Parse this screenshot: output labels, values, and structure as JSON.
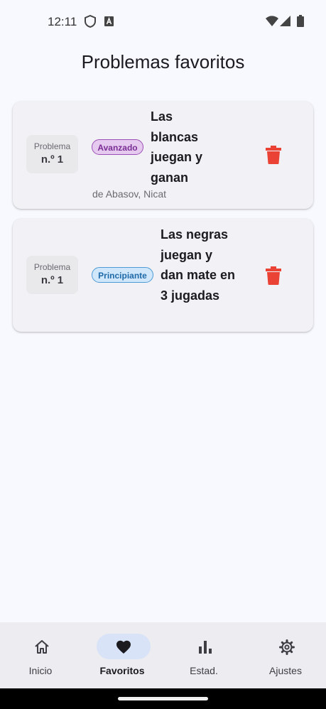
{
  "status": {
    "time": "12:11",
    "left_icons": [
      "shield-icon",
      "font-a-icon"
    ],
    "right_icons": [
      "wifi-icon",
      "signal-icon",
      "battery-icon"
    ]
  },
  "page": {
    "title": "Problemas favoritos"
  },
  "favorites": [
    {
      "number_label": "Problema",
      "number_value": "n.º 1",
      "level": "Avanzado",
      "title": "Las blancas juegan y ganan",
      "author": "de Abasov, Nicat"
    },
    {
      "number_label": "Problema",
      "number_value": "n.º 1",
      "level": "Principiante",
      "title": "Las negras juegan y dan mate en 3 jugadas",
      "author": ""
    }
  ],
  "nav": [
    {
      "label": "Inicio",
      "icon": "home-icon",
      "active": false
    },
    {
      "label": "Favoritos",
      "icon": "heart-icon",
      "active": true
    },
    {
      "label": "Estad.",
      "icon": "bar-chart-icon",
      "active": false
    },
    {
      "label": "Ajustes",
      "icon": "gear-icon",
      "active": false
    }
  ],
  "colors": {
    "delete": "#ea4335",
    "advanced_badge": "#e5c9ef",
    "beginner_badge": "#cfe6fb",
    "nav_active_pill": "#d8e3f8"
  }
}
